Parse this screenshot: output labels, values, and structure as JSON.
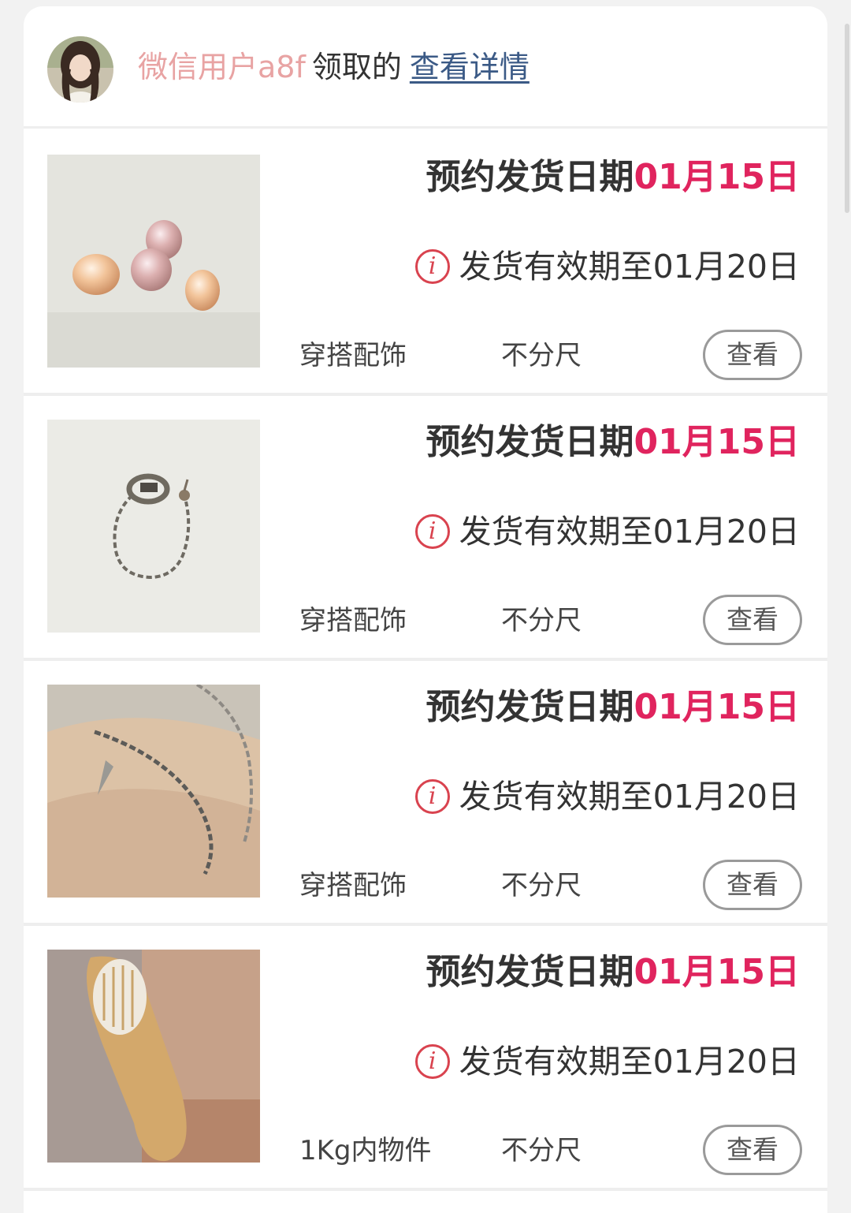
{
  "header": {
    "user_name": "微信用户a8f",
    "claim_text": "领取的",
    "detail_link": "查看详情"
  },
  "items": [
    {
      "image": "pearl-beads",
      "ship_label": "预约发货日期",
      "ship_date": "01月15日",
      "valid_text": "发货有效期至01月20日",
      "category": "穿搭配饰",
      "size": "不分尺",
      "button": "查看"
    },
    {
      "image": "ear-cuff-chain",
      "ship_label": "预约发货日期",
      "ship_date": "01月15日",
      "valid_text": "发货有效期至01月20日",
      "category": "穿搭配饰",
      "size": "不分尺",
      "button": "查看"
    },
    {
      "image": "silver-bracelet",
      "ship_label": "预约发货日期",
      "ship_date": "01月15日",
      "valid_text": "发货有效期至01月20日",
      "category": "穿搭配饰",
      "size": "不分尺",
      "button": "查看"
    },
    {
      "image": "wooden-hairbrush",
      "ship_label": "预约发货日期",
      "ship_date": "01月15日",
      "valid_text": "发货有效期至01月20日",
      "category": "1Kg内物件",
      "size": "不分尺",
      "button": "查看"
    }
  ],
  "colors": {
    "accent": "#e0245e",
    "link": "#3b5a86",
    "username": "#e8a3a3",
    "info_icon": "#d9434f"
  }
}
